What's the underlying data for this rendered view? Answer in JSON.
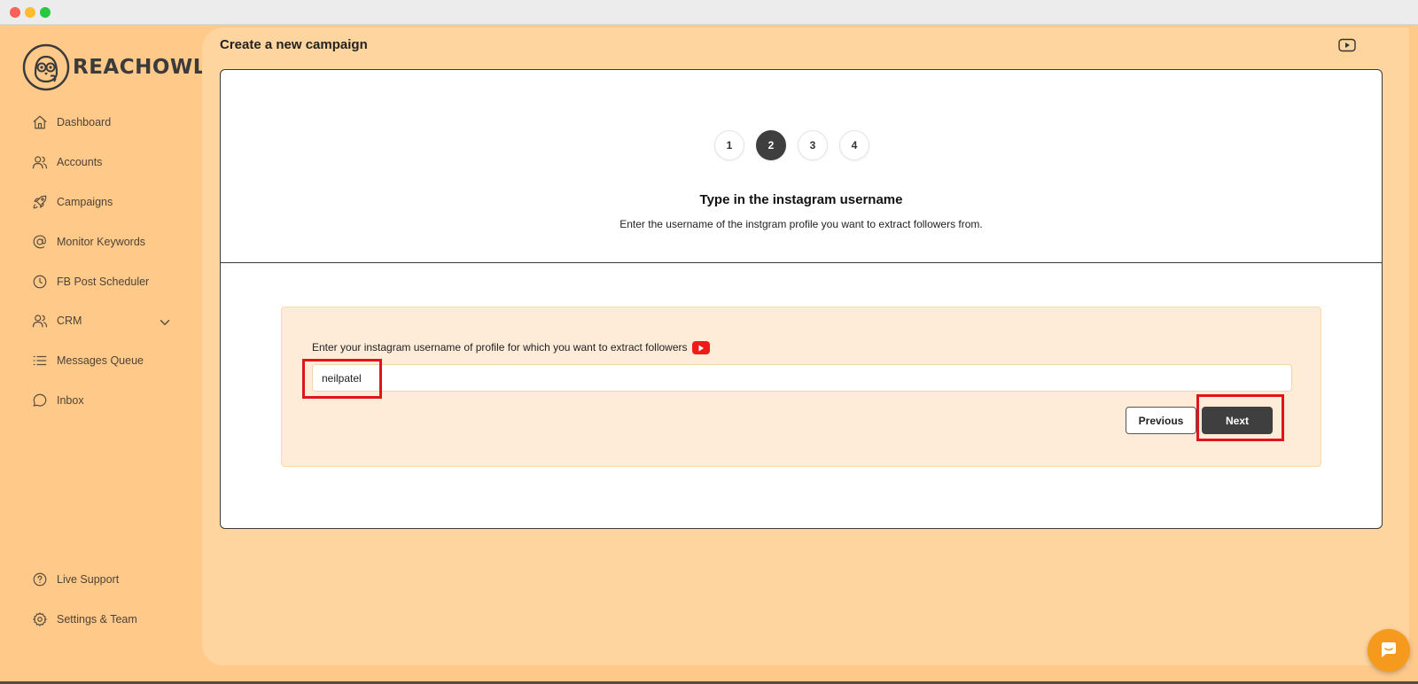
{
  "brand": {
    "name": "REACHOWL"
  },
  "sidebar": {
    "items": [
      {
        "label": "Dashboard",
        "icon": "home-icon"
      },
      {
        "label": "Accounts",
        "icon": "users-icon"
      },
      {
        "label": "Campaigns",
        "icon": "rocket-icon"
      },
      {
        "label": "Monitor Keywords",
        "icon": "at-sign-icon"
      },
      {
        "label": "FB Post Scheduler",
        "icon": "clock-icon"
      },
      {
        "label": "CRM",
        "icon": "users-icon",
        "expandable": true
      },
      {
        "label": "Messages Queue",
        "icon": "list-icon"
      },
      {
        "label": "Inbox",
        "icon": "message-circle-icon"
      }
    ],
    "footer_items": [
      {
        "label": "Live Support",
        "icon": "help-circle-icon"
      },
      {
        "label": "Settings & Team",
        "icon": "gear-icon"
      }
    ]
  },
  "header": {
    "title": "Create a new campaign"
  },
  "wizard": {
    "steps": [
      "1",
      "2",
      "3",
      "4"
    ],
    "active_step": "2",
    "heading": "Type in the instagram username",
    "description": "Enter the username of the instgram profile you want to extract followers from."
  },
  "form": {
    "label": "Enter your instagram username of profile for which you want to extract followers",
    "username_value": "neilpatel",
    "previous_label": "Previous",
    "next_label": "Next"
  },
  "colors": {
    "sidebar_bg": "#ffc98a",
    "main_bg": "#ffd59f",
    "panel_bg": "#feecd8",
    "primary_button": "#3f3f3f",
    "highlight": "#e0151c",
    "chat_bubble": "#f59a1c",
    "youtube_red": "#ef1b1b"
  }
}
